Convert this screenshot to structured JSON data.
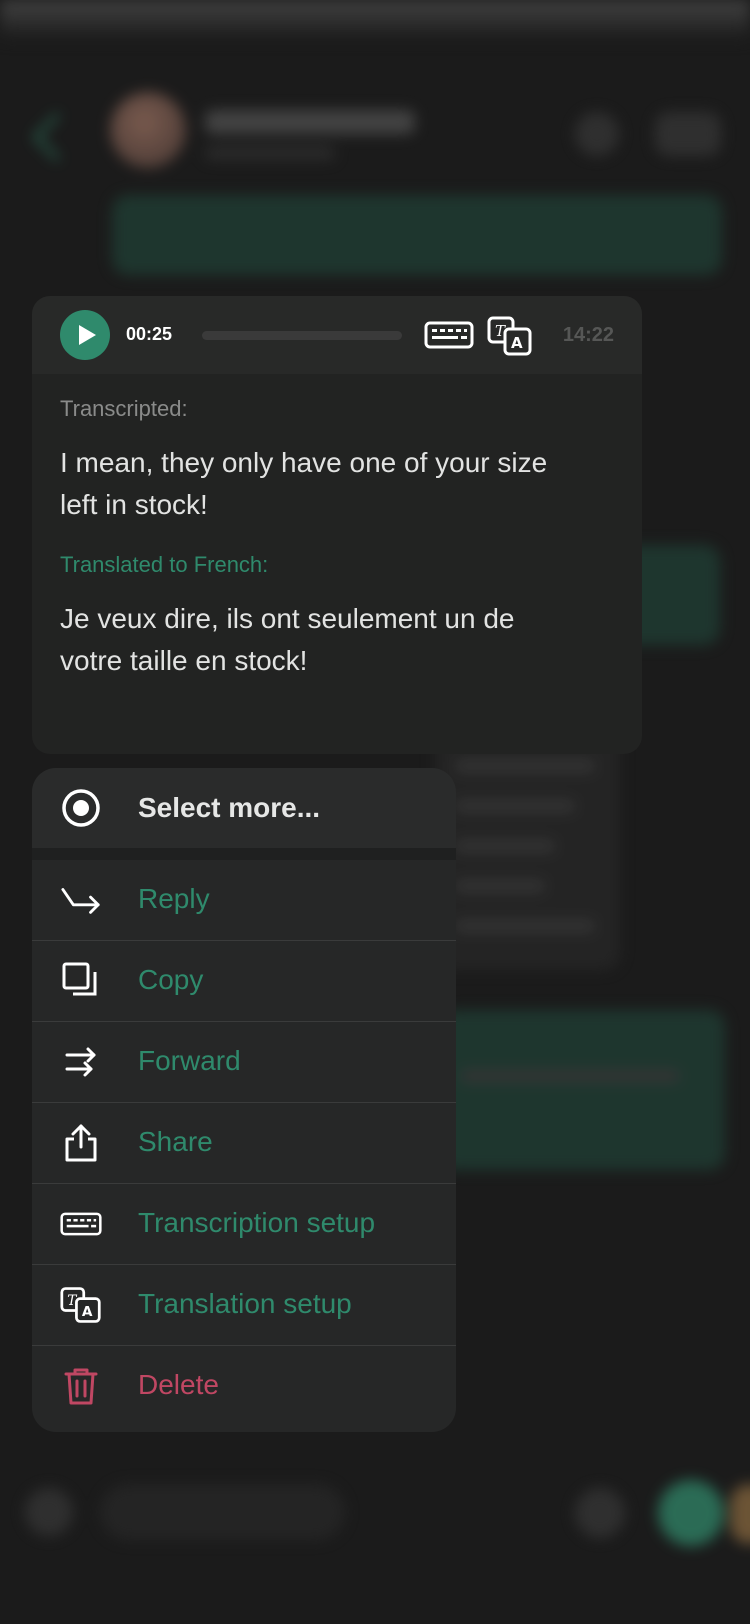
{
  "voice_message": {
    "duration": "00:25",
    "progress": 0,
    "time": "14:22",
    "icons": [
      "play-icon",
      "keyboard-icon",
      "translate-icon"
    ],
    "transcription_label": "Transcripted:",
    "transcription_text": "I mean, they only have one of your size left in stock!",
    "translation_label": "Translated to French:",
    "translation_text": "Je veux dire, ils ont seulement un de votre taille en stock!"
  },
  "context_menu": {
    "select_more": {
      "label": "Select more...",
      "icon": "radio-target-icon"
    },
    "items": [
      {
        "label": "Reply",
        "icon": "reply-arrow-icon"
      },
      {
        "label": "Copy",
        "icon": "copy-icon"
      },
      {
        "label": "Forward",
        "icon": "forward-arrows-icon"
      },
      {
        "label": "Share",
        "icon": "share-icon"
      },
      {
        "label": "Transcription setup",
        "icon": "keyboard-icon"
      },
      {
        "label": "Translation setup",
        "icon": "translate-icon"
      },
      {
        "label": "Delete",
        "icon": "trash-icon"
      }
    ]
  },
  "colors": {
    "accent": "#2f8a6c",
    "danger": "#c04763",
    "background": "#1b1b1b",
    "card": "#222322"
  }
}
